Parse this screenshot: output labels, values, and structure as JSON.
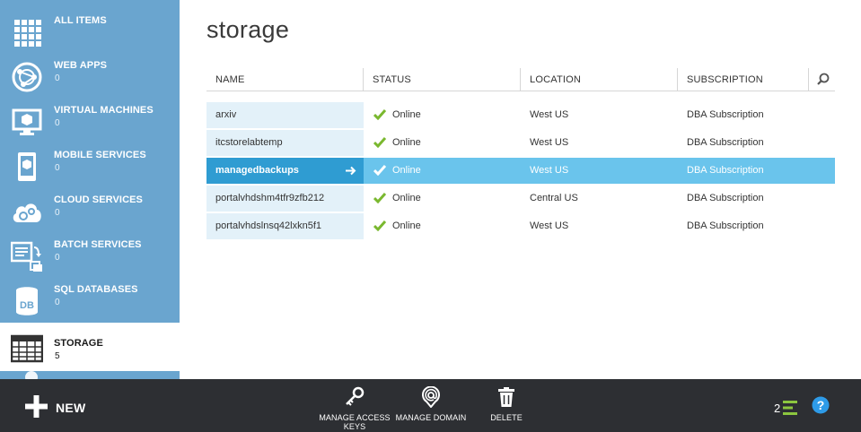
{
  "sidebar": {
    "items": [
      {
        "label": "ALL ITEMS",
        "count": ""
      },
      {
        "label": "WEB APPS",
        "count": "0"
      },
      {
        "label": "VIRTUAL MACHINES",
        "count": "0"
      },
      {
        "label": "MOBILE SERVICES",
        "count": "0"
      },
      {
        "label": "CLOUD SERVICES",
        "count": "0"
      },
      {
        "label": "BATCH SERVICES",
        "count": "0"
      },
      {
        "label": "SQL DATABASES",
        "count": "0"
      },
      {
        "label": "STORAGE",
        "count": "5"
      }
    ],
    "db_icon_text": "DB",
    "active_index": 7
  },
  "main": {
    "title": "storage",
    "columns": [
      "NAME",
      "STATUS",
      "LOCATION",
      "SUBSCRIPTION"
    ],
    "rows": [
      {
        "name": "arxiv",
        "status": "Online",
        "location": "West US",
        "subscription": "DBA Subscription"
      },
      {
        "name": "itcstorelabtemp",
        "status": "Online",
        "location": "West US",
        "subscription": "DBA Subscription"
      },
      {
        "name": "managedbackups",
        "status": "Online",
        "location": "West US",
        "subscription": "DBA Subscription"
      },
      {
        "name": "portalvhdshm4tfr9zfb212",
        "status": "Online",
        "location": "Central US",
        "subscription": "DBA Subscription"
      },
      {
        "name": "portalvhdslnsq42lxkn5f1",
        "status": "Online",
        "location": "West US",
        "subscription": "DBA Subscription"
      }
    ],
    "selected_row": 2
  },
  "bottom_bar": {
    "new_label": "NEW",
    "commands": [
      {
        "label_line1": "MANAGE ACCESS",
        "label_line2": "KEYS",
        "icon": "key-icon"
      },
      {
        "label_line1": "MANAGE DOMAIN",
        "label_line2": "",
        "icon": "at-icon"
      },
      {
        "label_line1": "DELETE",
        "label_line2": "",
        "icon": "trash-icon"
      }
    ],
    "progress_count": "2"
  },
  "colors": {
    "sidebar_bg": "#6aa5cf",
    "bottom_bar_bg": "#2d2f33",
    "selected_row": "#6ac4ec",
    "selected_name": "#2f9cd2",
    "name_cell_bg": "#e3f1f9",
    "check_green": "#7ab82f",
    "help_blue": "#2e9be8"
  }
}
